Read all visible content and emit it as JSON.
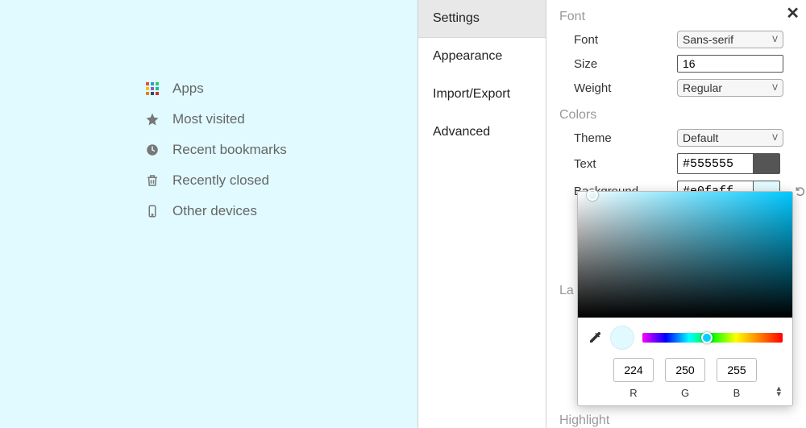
{
  "ntp": {
    "apps_colors": [
      "#e74c3c",
      "#3498db",
      "#2ecc71",
      "#f1c40f",
      "#9b59b6",
      "#1abc9c",
      "#e67e22",
      "#34495e",
      "#c0392b"
    ],
    "items": [
      {
        "label": "Apps",
        "icon": "apps"
      },
      {
        "label": "Most visited",
        "icon": "star"
      },
      {
        "label": "Recent bookmarks",
        "icon": "clock"
      },
      {
        "label": "Recently closed",
        "icon": "trash"
      },
      {
        "label": "Other devices",
        "icon": "device"
      }
    ]
  },
  "tabs": [
    {
      "label": "Settings",
      "active": true
    },
    {
      "label": "Appearance",
      "active": false
    },
    {
      "label": "Import/Export",
      "active": false
    },
    {
      "label": "Advanced",
      "active": false
    }
  ],
  "panel": {
    "font_header": "Font",
    "font": {
      "font_label": "Font",
      "font_value": "Sans-serif",
      "size_label": "Size",
      "size_value": "16",
      "weight_label": "Weight",
      "weight_value": "Regular"
    },
    "colors_header": "Colors",
    "colors": {
      "theme_label": "Theme",
      "theme_value": "Default",
      "text_label": "Text",
      "text_value": "#555555",
      "text_swatch": "#555555",
      "bg_label": "Background",
      "bg_value": "#e0faff",
      "bg_swatch": "#e0faff"
    },
    "partial_layout_label": "La",
    "partial_highlight_label": "Highlight"
  },
  "picker": {
    "r_value": "224",
    "g_value": "250",
    "b_value": "255",
    "r_label": "R",
    "g_label": "G",
    "b_label": "B",
    "preview_color": "#e0faff"
  }
}
